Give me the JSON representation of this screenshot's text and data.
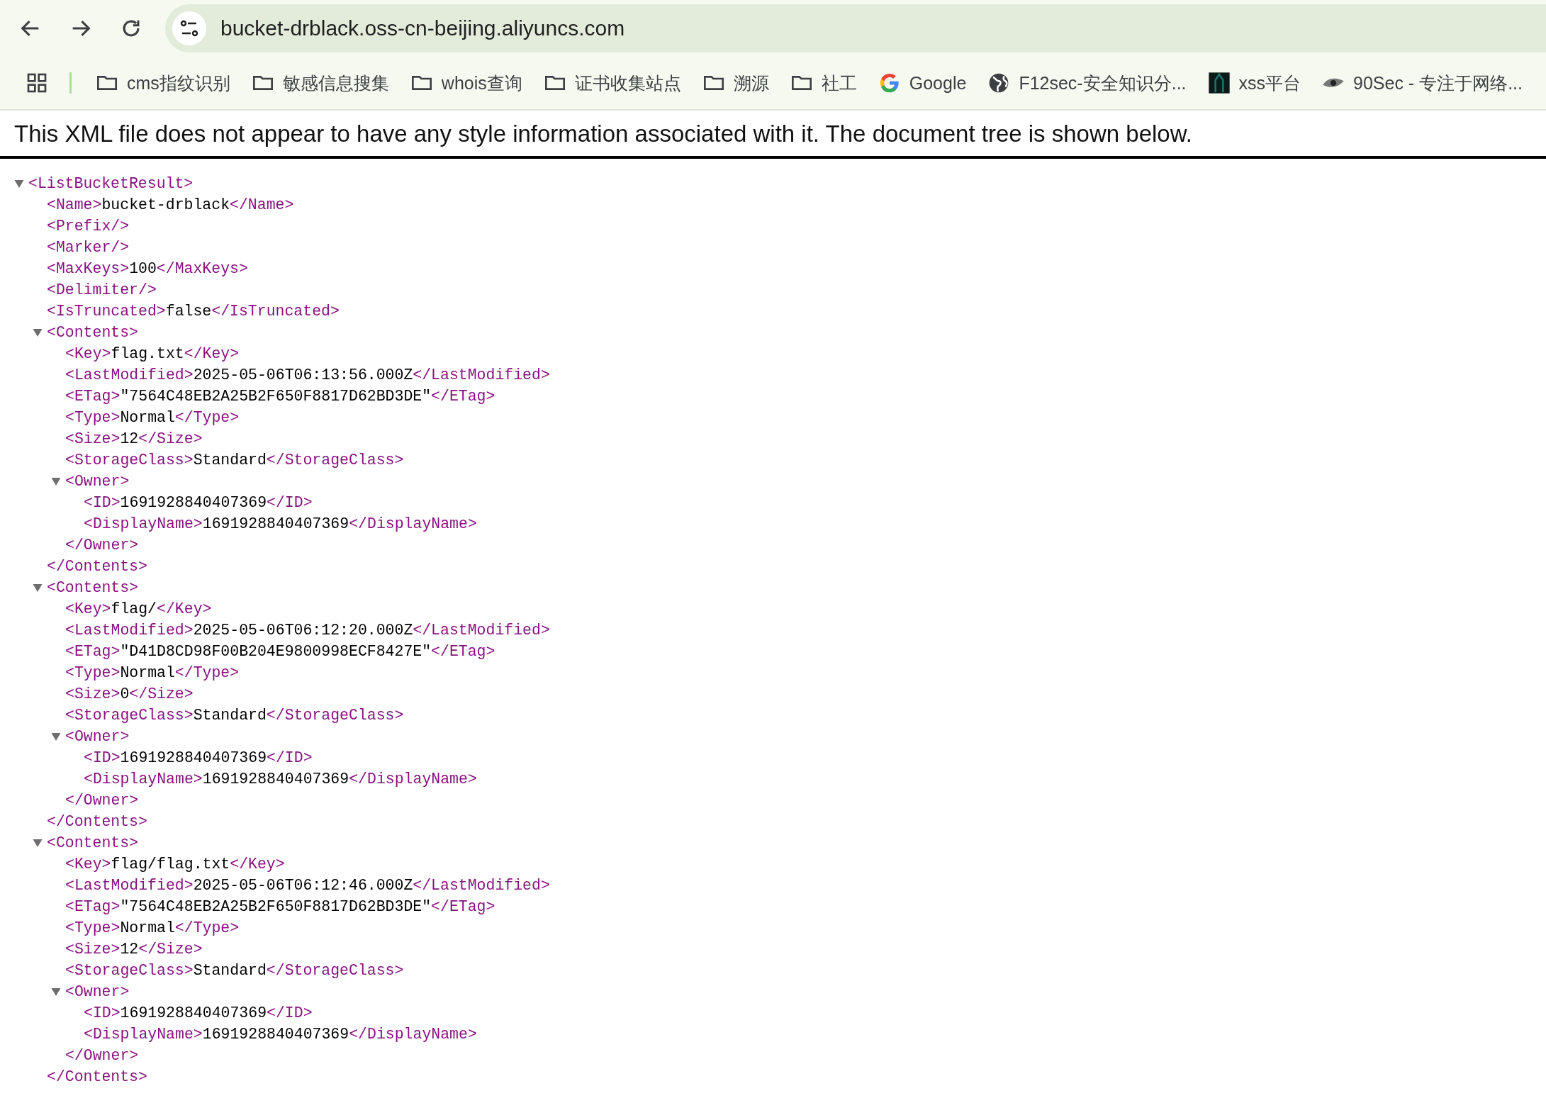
{
  "address_bar": {
    "url": "bucket-drblack.oss-cn-beijing.aliyuncs.com"
  },
  "bookmarks": [
    {
      "kind": "folder",
      "label": "cms指纹识别"
    },
    {
      "kind": "folder",
      "label": "敏感信息搜集"
    },
    {
      "kind": "folder",
      "label": "whois查询"
    },
    {
      "kind": "folder",
      "label": "证书收集站点"
    },
    {
      "kind": "folder",
      "label": "溯源"
    },
    {
      "kind": "folder",
      "label": "社工"
    },
    {
      "kind": "google",
      "label": "Google"
    },
    {
      "kind": "globe",
      "label": "F12sec-安全知识分..."
    },
    {
      "kind": "image",
      "label": "xss平台"
    },
    {
      "kind": "logo",
      "label": "90Sec - 专注于网络..."
    }
  ],
  "notice": "This XML file does not appear to have any style information associated with it. The document tree is shown below.",
  "xml_tree": {
    "kind": "element",
    "open_tag": "<ListBucketResult>",
    "expanded": true,
    "children": [
      {
        "kind": "text",
        "open_tag": "<Name>",
        "value": "bucket-drblack",
        "close_tag": "</Name>"
      },
      {
        "kind": "empty",
        "tag": "<Prefix/>"
      },
      {
        "kind": "empty",
        "tag": "<Marker/>"
      },
      {
        "kind": "text",
        "open_tag": "<MaxKeys>",
        "value": "100",
        "close_tag": "</MaxKeys>"
      },
      {
        "kind": "empty",
        "tag": "<Delimiter/>"
      },
      {
        "kind": "text",
        "open_tag": "<IsTruncated>",
        "value": "false",
        "close_tag": "</IsTruncated>"
      },
      {
        "kind": "element",
        "open_tag": "<Contents>",
        "expanded": true,
        "close_tag": "</Contents>",
        "children": [
          {
            "kind": "text",
            "open_tag": "<Key>",
            "value": "flag.txt",
            "close_tag": "</Key>"
          },
          {
            "kind": "text",
            "open_tag": "<LastModified>",
            "value": "2025-05-06T06:13:56.000Z",
            "close_tag": "</LastModified>"
          },
          {
            "kind": "text",
            "open_tag": "<ETag>",
            "value": "\"7564C48EB2A25B2F650F8817D62BD3DE\"",
            "close_tag": "</ETag>"
          },
          {
            "kind": "text",
            "open_tag": "<Type>",
            "value": "Normal",
            "close_tag": "</Type>"
          },
          {
            "kind": "text",
            "open_tag": "<Size>",
            "value": "12",
            "close_tag": "</Size>"
          },
          {
            "kind": "text",
            "open_tag": "<StorageClass>",
            "value": "Standard",
            "close_tag": "</StorageClass>"
          },
          {
            "kind": "element",
            "open_tag": "<Owner>",
            "expanded": true,
            "close_tag": "</Owner>",
            "children": [
              {
                "kind": "text",
                "open_tag": "<ID>",
                "value": "1691928840407369",
                "close_tag": "</ID>"
              },
              {
                "kind": "text",
                "open_tag": "<DisplayName>",
                "value": "1691928840407369",
                "close_tag": "</DisplayName>"
              }
            ]
          }
        ]
      },
      {
        "kind": "element",
        "open_tag": "<Contents>",
        "expanded": true,
        "close_tag": "</Contents>",
        "children": [
          {
            "kind": "text",
            "open_tag": "<Key>",
            "value": "flag/",
            "close_tag": "</Key>"
          },
          {
            "kind": "text",
            "open_tag": "<LastModified>",
            "value": "2025-05-06T06:12:20.000Z",
            "close_tag": "</LastModified>"
          },
          {
            "kind": "text",
            "open_tag": "<ETag>",
            "value": "\"D41D8CD98F00B204E9800998ECF8427E\"",
            "close_tag": "</ETag>"
          },
          {
            "kind": "text",
            "open_tag": "<Type>",
            "value": "Normal",
            "close_tag": "</Type>"
          },
          {
            "kind": "text",
            "open_tag": "<Size>",
            "value": "0",
            "close_tag": "</Size>"
          },
          {
            "kind": "text",
            "open_tag": "<StorageClass>",
            "value": "Standard",
            "close_tag": "</StorageClass>"
          },
          {
            "kind": "element",
            "open_tag": "<Owner>",
            "expanded": true,
            "close_tag": "</Owner>",
            "children": [
              {
                "kind": "text",
                "open_tag": "<ID>",
                "value": "1691928840407369",
                "close_tag": "</ID>"
              },
              {
                "kind": "text",
                "open_tag": "<DisplayName>",
                "value": "1691928840407369",
                "close_tag": "</DisplayName>"
              }
            ]
          }
        ]
      },
      {
        "kind": "element",
        "open_tag": "<Contents>",
        "expanded": true,
        "close_tag": "</Contents>",
        "children": [
          {
            "kind": "text",
            "open_tag": "<Key>",
            "value": "flag/flag.txt",
            "close_tag": "</Key>"
          },
          {
            "kind": "text",
            "open_tag": "<LastModified>",
            "value": "2025-05-06T06:12:46.000Z",
            "close_tag": "</LastModified>"
          },
          {
            "kind": "text",
            "open_tag": "<ETag>",
            "value": "\"7564C48EB2A25B2F650F8817D62BD3DE\"",
            "close_tag": "</ETag>"
          },
          {
            "kind": "text",
            "open_tag": "<Type>",
            "value": "Normal",
            "close_tag": "</Type>"
          },
          {
            "kind": "text",
            "open_tag": "<Size>",
            "value": "12",
            "close_tag": "</Size>"
          },
          {
            "kind": "text",
            "open_tag": "<StorageClass>",
            "value": "Standard",
            "close_tag": "</StorageClass>"
          },
          {
            "kind": "element",
            "open_tag": "<Owner>",
            "expanded": true,
            "close_tag": "</Owner>",
            "children": [
              {
                "kind": "text",
                "open_tag": "<ID>",
                "value": "1691928840407369",
                "close_tag": "</ID>"
              },
              {
                "kind": "text",
                "open_tag": "<DisplayName>",
                "value": "1691928840407369",
                "close_tag": "</DisplayName>"
              }
            ]
          }
        ]
      }
    ]
  }
}
